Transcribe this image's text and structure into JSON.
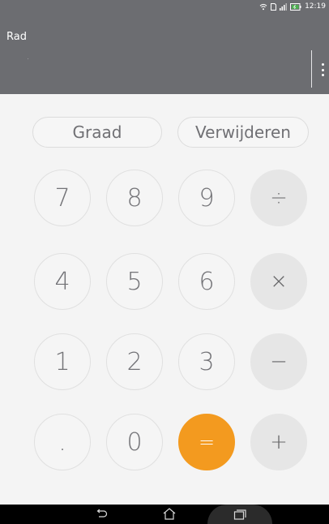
{
  "status_bar": {
    "time": "12:19",
    "icons": [
      "wifi-icon",
      "sim-icon",
      "signal-icon",
      "battery-icon"
    ]
  },
  "display": {
    "mode": "Rad",
    "expression": "",
    "result": ""
  },
  "buttons": {
    "degree": "Graad",
    "delete": "Verwijderen"
  },
  "keypad": {
    "row1": [
      "7",
      "8",
      "9",
      "÷"
    ],
    "row2": [
      "4",
      "5",
      "6",
      "×"
    ],
    "row3": [
      "1",
      "2",
      "3",
      "−"
    ],
    "row4": [
      ".",
      "0",
      "=",
      "+"
    ]
  },
  "nav_bar": {
    "icons": [
      "back-icon",
      "home-icon",
      "recent-apps-icon"
    ]
  },
  "colors": {
    "header": "#6c6d71",
    "accent": "#f39a1f",
    "background": "#f4f4f4",
    "operator_key": "#e6e6e6"
  }
}
